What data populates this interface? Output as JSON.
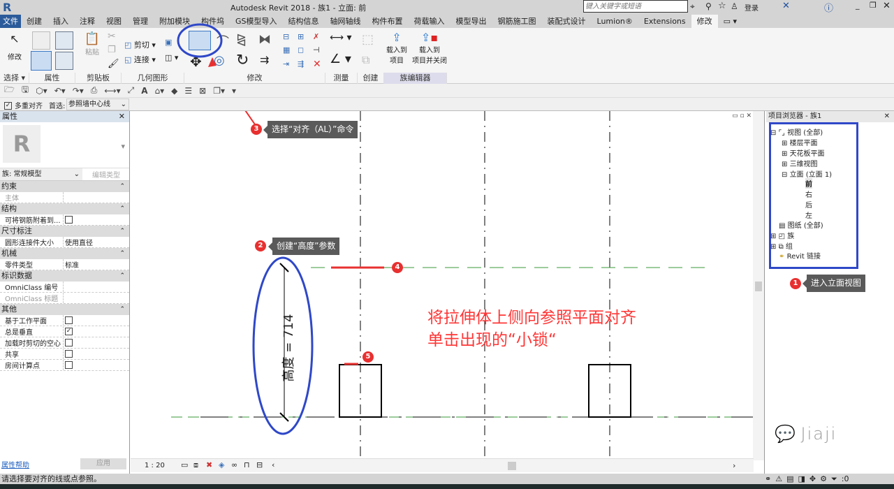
{
  "window": {
    "title": "Autodesk Revit 2018 -    族1 - 立面: 前",
    "search_placeholder": "键入关键字或短语",
    "login": "登录"
  },
  "tabs": [
    "文件",
    "创建",
    "插入",
    "注释",
    "视图",
    "管理",
    "附加模块",
    "构件坞",
    "GS模型导入",
    "结构信息",
    "轴网轴线",
    "构件布置",
    "荷载输入",
    "模型导出",
    "钢筋施工图",
    "装配式设计",
    "Lumion®",
    "Extensions",
    "修改"
  ],
  "active_tab": "修改",
  "ribbon": {
    "modify_label": "修改",
    "paste_label": "粘贴",
    "cut_label": "剪切",
    "join_label": "连接",
    "load_project": "载入到\n项目",
    "load_project_line1": "载入到",
    "load_project_line2": "项目",
    "load_close_line1": "载入到",
    "load_close_line2": "项目并关闭",
    "panels": [
      "选择 ▾",
      "属性",
      "剪贴板",
      "几何图形",
      "修改",
      "测量",
      "创建",
      "族编辑器"
    ]
  },
  "options_bar": {
    "multi_align": "多重对齐",
    "prefer_label": "首选:",
    "prefer_value": "参照墙中心线",
    "multi_align_checked": true
  },
  "properties": {
    "title": "属性",
    "family": "族: 常规模型",
    "edit_type": "编辑类型",
    "groups": [
      {
        "name": "约束",
        "rows": [
          {
            "k": "主体",
            "v": ""
          }
        ]
      },
      {
        "name": "结构",
        "rows": [
          {
            "k": "可将钢筋附着到...",
            "v": "",
            "checkbox": false
          }
        ]
      },
      {
        "name": "尺寸标注",
        "rows": [
          {
            "k": "圆形连接件大小",
            "v": "使用直径"
          }
        ]
      },
      {
        "name": "机械",
        "rows": [
          {
            "k": "零件类型",
            "v": "标准"
          }
        ]
      },
      {
        "name": "标识数据",
        "rows": [
          {
            "k": "OmniClass 编号",
            "v": ""
          },
          {
            "k": "OmniClass 标题",
            "v": ""
          }
        ]
      },
      {
        "name": "其他",
        "rows": [
          {
            "k": "基于工作平面",
            "v": "",
            "checkbox": false
          },
          {
            "k": "总是垂直",
            "v": "",
            "checkbox": true
          },
          {
            "k": "加载时剪切的空心",
            "v": "",
            "checkbox": false
          },
          {
            "k": "共享",
            "v": "",
            "checkbox": false
          },
          {
            "k": "房间计算点",
            "v": "",
            "checkbox": false
          }
        ]
      }
    ],
    "help": "属性帮助",
    "apply": "应用"
  },
  "canvas": {
    "scale": "1 : 20",
    "dimension": "高度 = 714",
    "note_line1": "将拉伸体上侧向参照平面对齐",
    "note_line2": "单击出现的“小锁“",
    "watermark": "Jiaji"
  },
  "annotations": {
    "m1": "1",
    "m2": "2",
    "m3": "3",
    "m4": "4",
    "m5": "5",
    "tip1": "进入立面视图",
    "tip2": "创建“高度”参数",
    "tip3": "选择“对齐（AL）”命令"
  },
  "browser": {
    "title": "项目浏览器 - 族1",
    "items": [
      "视图 (全部)",
      "楼层平面",
      "天花板平面",
      "三维视图",
      "立面 (立面 1)",
      "前",
      "右",
      "后",
      "左",
      "图纸 (全部)",
      "族",
      "组",
      "Revit 链接"
    ]
  },
  "status": {
    "text": "请选择要对齐的线或点参照。",
    "filter_count": ":0"
  },
  "colors": {
    "annotation_red": "#e83030",
    "highlight_blue": "#2f48c8",
    "ref_green": "#3a9a3a"
  }
}
